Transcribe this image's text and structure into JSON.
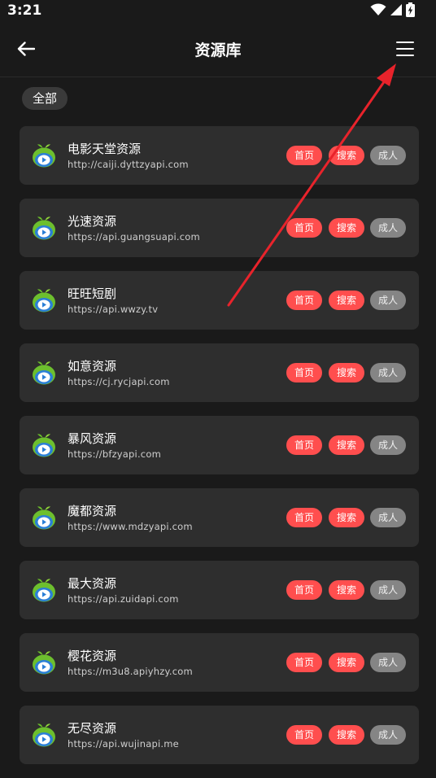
{
  "status_bar": {
    "time": "3:21",
    "icons": [
      "wifi-icon",
      "signal-icon",
      "battery-charging-icon"
    ]
  },
  "app_bar": {
    "back_icon": "arrow-left-icon",
    "title": "资源库",
    "menu_icon": "menu-icon"
  },
  "filter": {
    "label": "全部"
  },
  "tags": {
    "home": "首页",
    "search": "搜索",
    "adult": "成人"
  },
  "colors": {
    "background": "#1a1a1a",
    "card": "#2e2e2e",
    "tag_red": "#ff4e4e",
    "tag_gray": "#858585",
    "annotation_arrow": "#e8232b"
  },
  "sources": [
    {
      "name": "电影天堂资源",
      "url": "http://caiji.dyttzyapi.com"
    },
    {
      "name": "光速资源",
      "url": "https://api.guangsuapi.com"
    },
    {
      "name": "旺旺短剧",
      "url": "https://api.wwzy.tv"
    },
    {
      "name": "如意资源",
      "url": "https://cj.rycjapi.com"
    },
    {
      "name": "暴风资源",
      "url": "https://bfzyapi.com"
    },
    {
      "name": "魔都资源",
      "url": "https://www.mdzyapi.com"
    },
    {
      "name": "最大资源",
      "url": "https://api.zuidapi.com"
    },
    {
      "name": "樱花资源",
      "url": "https://m3u8.apiyhzy.com"
    },
    {
      "name": "无尽资源",
      "url": "https://api.wujinapi.me"
    }
  ]
}
